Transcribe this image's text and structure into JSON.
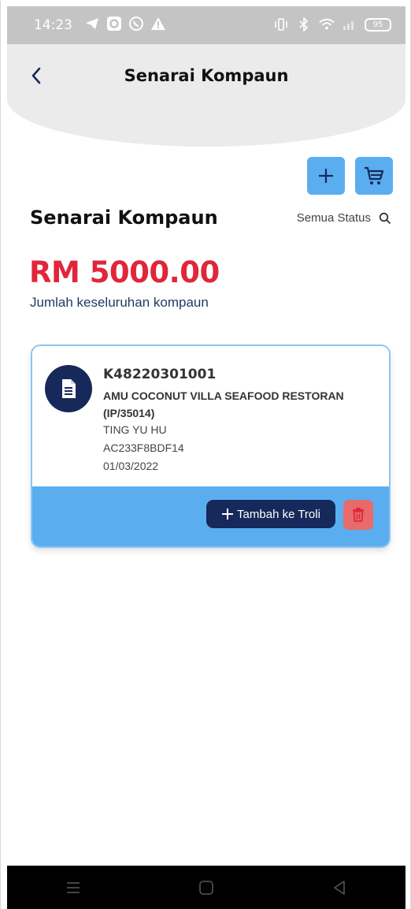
{
  "status_bar": {
    "time": "14:23",
    "battery": "95",
    "icons_left": [
      "telegram-icon",
      "outlook-icon",
      "whatsapp-icon",
      "warning-icon"
    ],
    "icons_right": [
      "vibrate-icon",
      "bluetooth-icon",
      "wifi-icon",
      "signal-icon",
      "battery-icon"
    ]
  },
  "header": {
    "title": "Senarai Kompaun"
  },
  "section": {
    "title": "Senarai Kompaun",
    "filter_label": "Semua Status"
  },
  "summary": {
    "total": "RM 5000.00",
    "caption": "Jumlah keseluruhan kompaun"
  },
  "compounds": [
    {
      "code": "K48220301001",
      "name": "AMU COCONUT VILLA SEAFOOD RESTORAN (IP/35014)",
      "person": "TING YU HU",
      "reference": "AC233F8BDF14",
      "date": "01/03/2022",
      "add_to_cart_label": "Tambah ke Troli"
    }
  ],
  "colors": {
    "accent": "#5aaef0",
    "navy": "#16295a",
    "total_red": "#e0263a",
    "delete_red": "#e86a6a"
  }
}
